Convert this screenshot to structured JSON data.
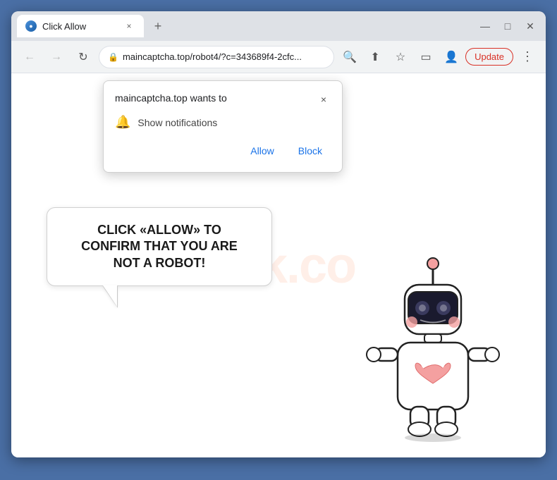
{
  "browser": {
    "tab_title": "Click Allow",
    "tab_close": "×",
    "tab_new": "+",
    "window_controls": {
      "minimize": "—",
      "maximize": "□",
      "close": "✕"
    },
    "toolbar": {
      "back": "←",
      "forward": "→",
      "reload": "↻",
      "address": "maincaptcha.top/robot4/?c=343689f4-2cfc...",
      "update_label": "Update"
    }
  },
  "permission_popup": {
    "title": "maincaptcha.top wants to",
    "notification_label": "Show notifications",
    "allow_label": "Allow",
    "block_label": "Block",
    "close": "×"
  },
  "page": {
    "speech_bubble_text": "CLICK «ALLOW» TO CONFIRM THAT YOU ARE NOT A ROBOT!",
    "watermark": "risk.co"
  }
}
